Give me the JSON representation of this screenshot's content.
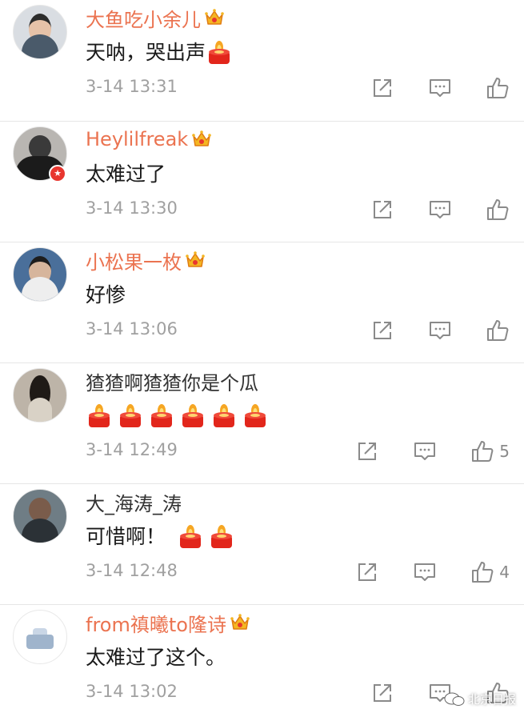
{
  "comments": [
    {
      "username": "大鱼吃小余儿",
      "text": "天呐，哭出声",
      "candles_after_text": 1,
      "time": "3-14 13:31",
      "likes": ""
    },
    {
      "username": "Heylilfreak",
      "text": "太难过了",
      "candles_after_text": 0,
      "time": "3-14 13:30",
      "likes": ""
    },
    {
      "username": "小松果一枚",
      "text": "好惨",
      "candles_after_text": 0,
      "time": "3-14 13:06",
      "likes": ""
    },
    {
      "username": "猹猹啊猹猹你是个瓜",
      "text": "",
      "candles_after_text": 6,
      "time": "3-14 12:49",
      "likes": "5"
    },
    {
      "username": "大_海涛_涛",
      "text": "可惜啊！",
      "candles_after_text": 2,
      "time": "3-14 12:48",
      "likes": "4"
    },
    {
      "username": "from禛曦to隆诗",
      "text": "太难过了这个。",
      "candles_after_text": 0,
      "time": "3-14 13:02",
      "likes": ""
    }
  ],
  "watermark": {
    "text": "北京日报"
  },
  "icons": {
    "vip": "crown-icon",
    "share": "share-icon",
    "reply": "comment-icon",
    "like": "thumbs-up-icon",
    "candle": "candle-emoji-icon",
    "verified": "verified-badge-icon"
  },
  "colors": {
    "username_vip": "#eb7350",
    "username_plain": "#333333",
    "timestamp": "#a0a0a0",
    "divider": "#e6e6e6",
    "icon": "#8a8a8a",
    "candle_body": "#e2261b",
    "candle_flame": "#f6a623"
  }
}
